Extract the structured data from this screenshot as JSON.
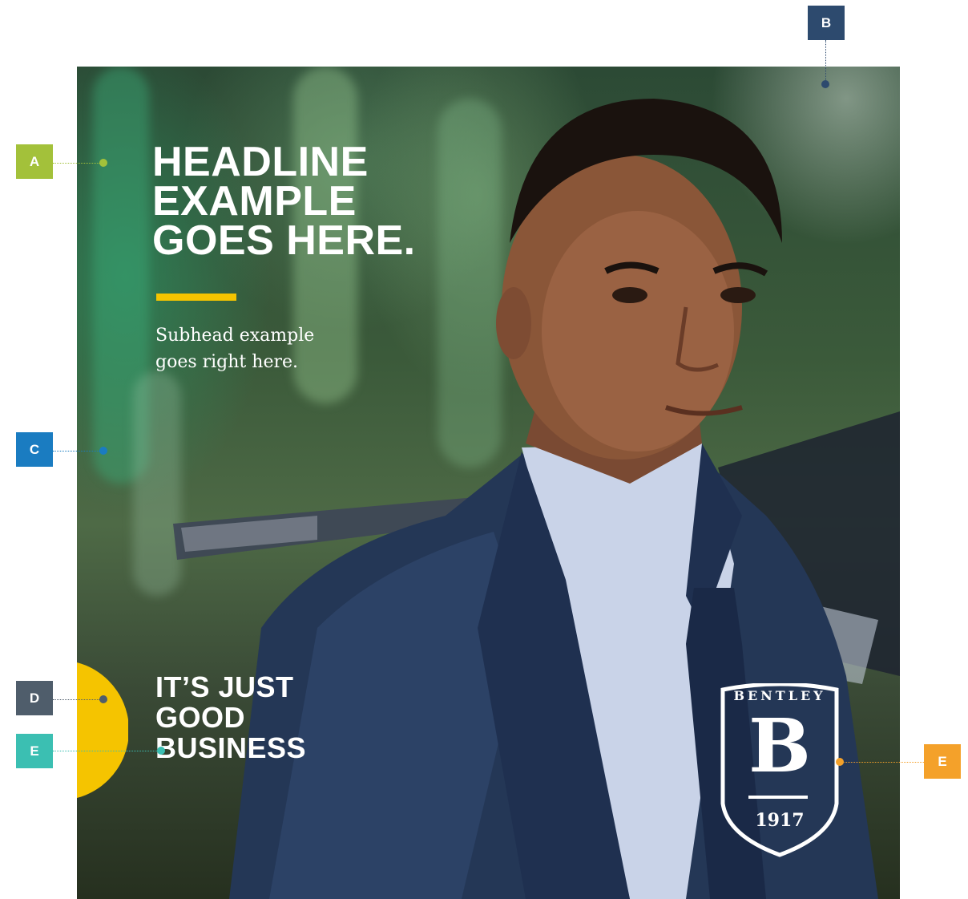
{
  "headline": {
    "line1": "HEADLINE",
    "line2": "EXAMPLE",
    "line3": "GOES HERE."
  },
  "subhead": {
    "line1": "Subhead example",
    "line2": "goes right here."
  },
  "tagline": {
    "line1": "IT’S JUST",
    "line2": "GOOD",
    "line3": "BUSINESS"
  },
  "logo": {
    "wordmark": "BENTLEY",
    "letter": "B",
    "year": "1917"
  },
  "callouts": [
    {
      "label": "A",
      "color": "#a3c13a"
    },
    {
      "label": "B",
      "color": "#2d4a6e"
    },
    {
      "label": "C",
      "color": "#1a7cc1"
    },
    {
      "label": "D",
      "color": "#4f5d6b"
    },
    {
      "label": "E",
      "color": "#3bbfb2"
    },
    {
      "label": "E",
      "color": "#f4a12a"
    }
  ],
  "colors": {
    "accent_yellow": "#f5c400",
    "text_white": "#ffffff"
  }
}
